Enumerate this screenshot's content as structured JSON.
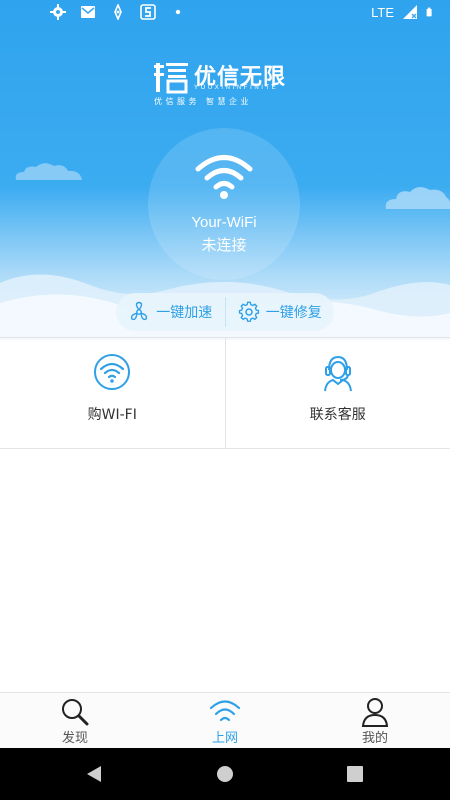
{
  "status_bar": {
    "network": "LTE",
    "icons": [
      "settings-icon",
      "mail-icon",
      "location-icon",
      "app-s-icon",
      "dot-icon",
      "signal-icon",
      "battery-icon"
    ]
  },
  "brand": {
    "name": "优信无限",
    "name_en": "YOUXININFINITE",
    "slogan": "优信服务 智慧企业",
    "logo_icon": "brand-logo-icon"
  },
  "wifi_status": {
    "ssid": "Your-WiFi",
    "state": "未连接",
    "icon": "wifi-icon"
  },
  "actions": [
    {
      "label": "一键加速",
      "icon": "fan-icon"
    },
    {
      "label": "一键修复",
      "icon": "gear-icon"
    }
  ],
  "services": [
    {
      "label": "购WI-FI",
      "icon": "wifi-circle-icon"
    },
    {
      "label": "联系客服",
      "icon": "customer-service-icon"
    }
  ],
  "bottom_nav": [
    {
      "label": "发现",
      "icon": "search-icon",
      "active": false
    },
    {
      "label": "上网",
      "icon": "wifi-icon",
      "active": true
    },
    {
      "label": "我的",
      "icon": "user-icon",
      "active": false
    }
  ],
  "colors": {
    "primary": "#2ea0e8",
    "hero_blue": "#35a7ef",
    "text_dark": "#333333",
    "nav_inactive": "#555555"
  }
}
